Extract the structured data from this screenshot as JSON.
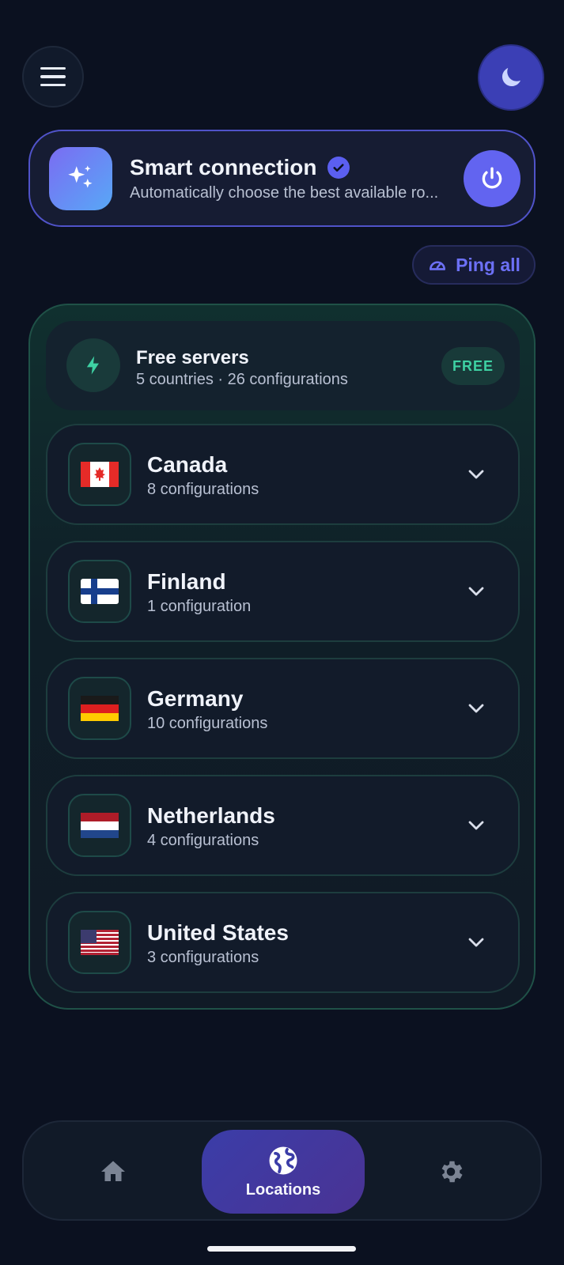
{
  "header": {
    "menu_icon": "hamburger-menu-icon",
    "theme_icon": "moon-icon"
  },
  "smart_connection": {
    "title": "Smart connection",
    "subtitle": "Automatically choose the best available ro...",
    "icon": "sparkles-icon",
    "verified_icon": "check-badge-icon",
    "power_icon": "power-icon"
  },
  "ping_all": {
    "label": "Ping all",
    "icon": "speedometer-icon"
  },
  "free_servers": {
    "title": "Free servers",
    "subtitle": "5 countries · 26 configurations",
    "badge": "FREE",
    "icon": "lightning-icon"
  },
  "countries": [
    {
      "name": "Canada",
      "configs": "8 configurations",
      "flag": "canada-flag"
    },
    {
      "name": "Finland",
      "configs": "1 configuration",
      "flag": "finland-flag"
    },
    {
      "name": "Germany",
      "configs": "10 configurations",
      "flag": "germany-flag"
    },
    {
      "name": "Netherlands",
      "configs": "4 configurations",
      "flag": "netherlands-flag"
    },
    {
      "name": "United States",
      "configs": "3 configurations",
      "flag": "united-states-flag"
    }
  ],
  "bottom_nav": {
    "home_icon": "home-icon",
    "locations_label": "Locations",
    "locations_icon": "globe-icon",
    "settings_icon": "gear-icon"
  },
  "colors": {
    "background": "#0b1120",
    "accent": "#6264f0",
    "free_green": "#3ed1a3"
  }
}
